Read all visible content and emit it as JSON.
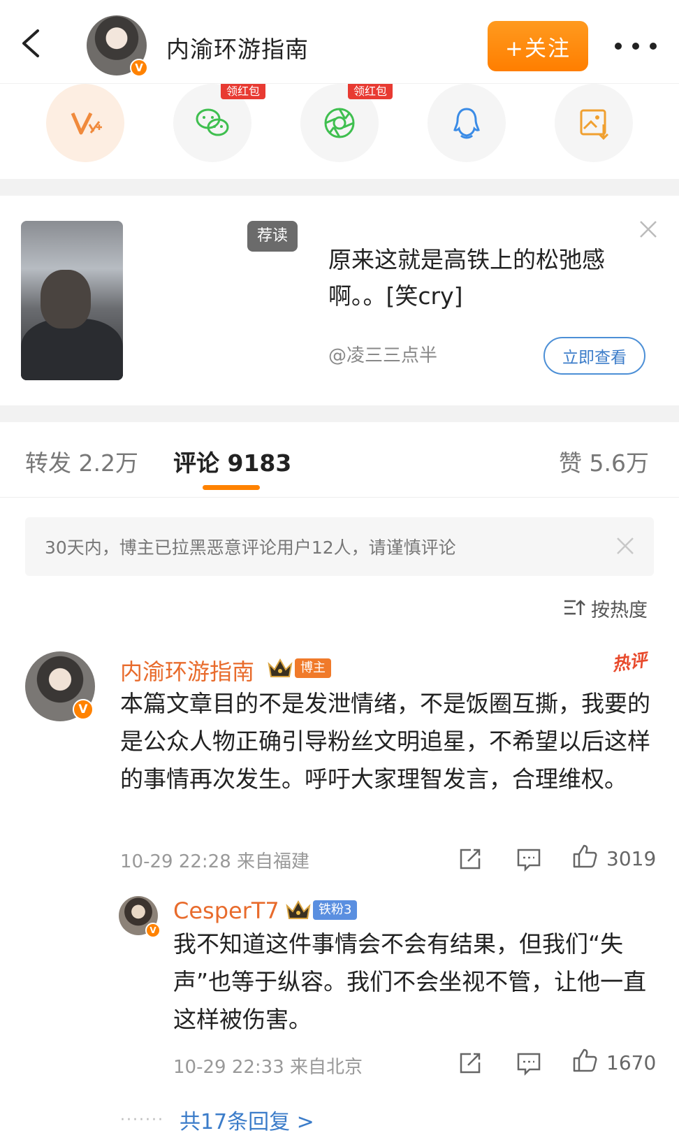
{
  "header": {
    "account_name": "内渝环游指南",
    "follow_label": "+关注",
    "verified_mark": "V"
  },
  "share": {
    "items": [
      {
        "icon": "weibo-vip-icon",
        "label": ""
      },
      {
        "icon": "wechat-icon",
        "badge": "领红包"
      },
      {
        "icon": "moments-icon",
        "badge": "领红包"
      },
      {
        "icon": "qq-icon"
      },
      {
        "icon": "save-image-icon"
      }
    ]
  },
  "recommend": {
    "tag": "荐读",
    "title": "原来这就是高铁上的松弛感啊。。[笑cry]",
    "author": "@凌三三点半",
    "view_label": "立即查看"
  },
  "tabs": {
    "repost": "转发 2.2万",
    "comments": "评论 9183",
    "likes": "赞 5.6万"
  },
  "notice": {
    "text": "30天内，博主已拉黑恶意评论用户12人，请谨慎评论"
  },
  "sort": {
    "label": "按热度"
  },
  "comment": {
    "author": "内渝环游指南",
    "role": "博主",
    "hot_tag": "热评",
    "text": "本篇文章目的不是发泄情绪，不是饭圈互撕，我要的是公众人物正确引导粉丝文明追星，不希望以后这样的事情再次发生。呼吁大家理智发言，合理维权。",
    "time": "10-29 22:28 来自福建",
    "likes": "3019"
  },
  "reply": {
    "author": "CesperT7",
    "role": "铁粉3",
    "text": "我不知道这件事情会不会有结果，但我们“失声”也等于纵容。我们不会坐视不管，让他一直这样被伤害。",
    "time": "10-29 22:33 来自北京",
    "likes": "1670"
  },
  "replies_link": "共17条回复 >",
  "colors": {
    "accent": "#ff8200",
    "name": "#e86b2c",
    "link": "#3b7cc9",
    "redpacket": "#e83a32"
  }
}
